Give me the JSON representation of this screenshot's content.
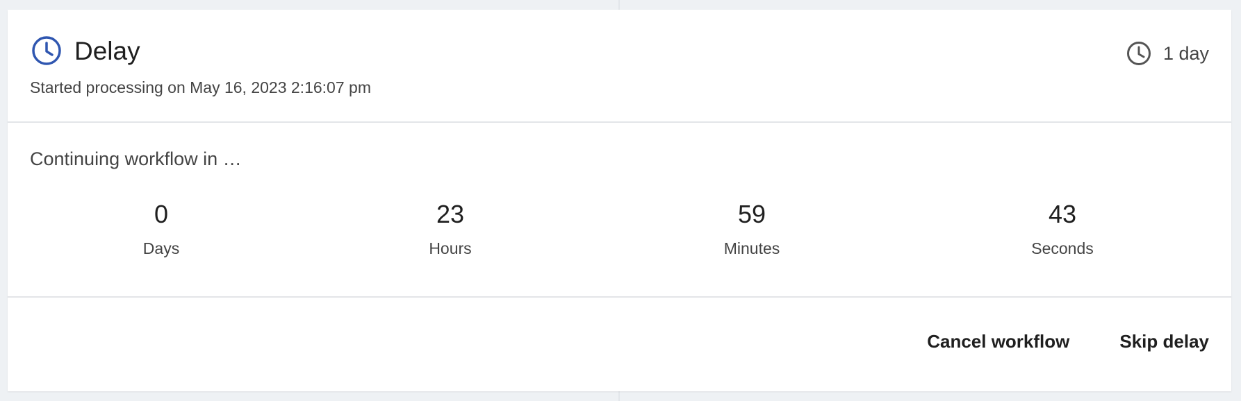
{
  "delay": {
    "title": "Delay",
    "subtitle": "Started processing on May 16, 2023 2:16:07 pm",
    "duration": "1 day",
    "icons": {
      "title_icon": "clock-icon",
      "duration_icon": "clock-icon"
    },
    "colors": {
      "accent": "#2f56b0",
      "text_primary": "#1f1f1f",
      "text_secondary": "#444444"
    }
  },
  "countdown": {
    "caption": "Continuing workflow in …",
    "units": [
      {
        "value": "0",
        "label": "Days"
      },
      {
        "value": "23",
        "label": "Hours"
      },
      {
        "value": "59",
        "label": "Minutes"
      },
      {
        "value": "43",
        "label": "Seconds"
      }
    ]
  },
  "actions": {
    "cancel_label": "Cancel workflow",
    "skip_label": "Skip delay"
  }
}
